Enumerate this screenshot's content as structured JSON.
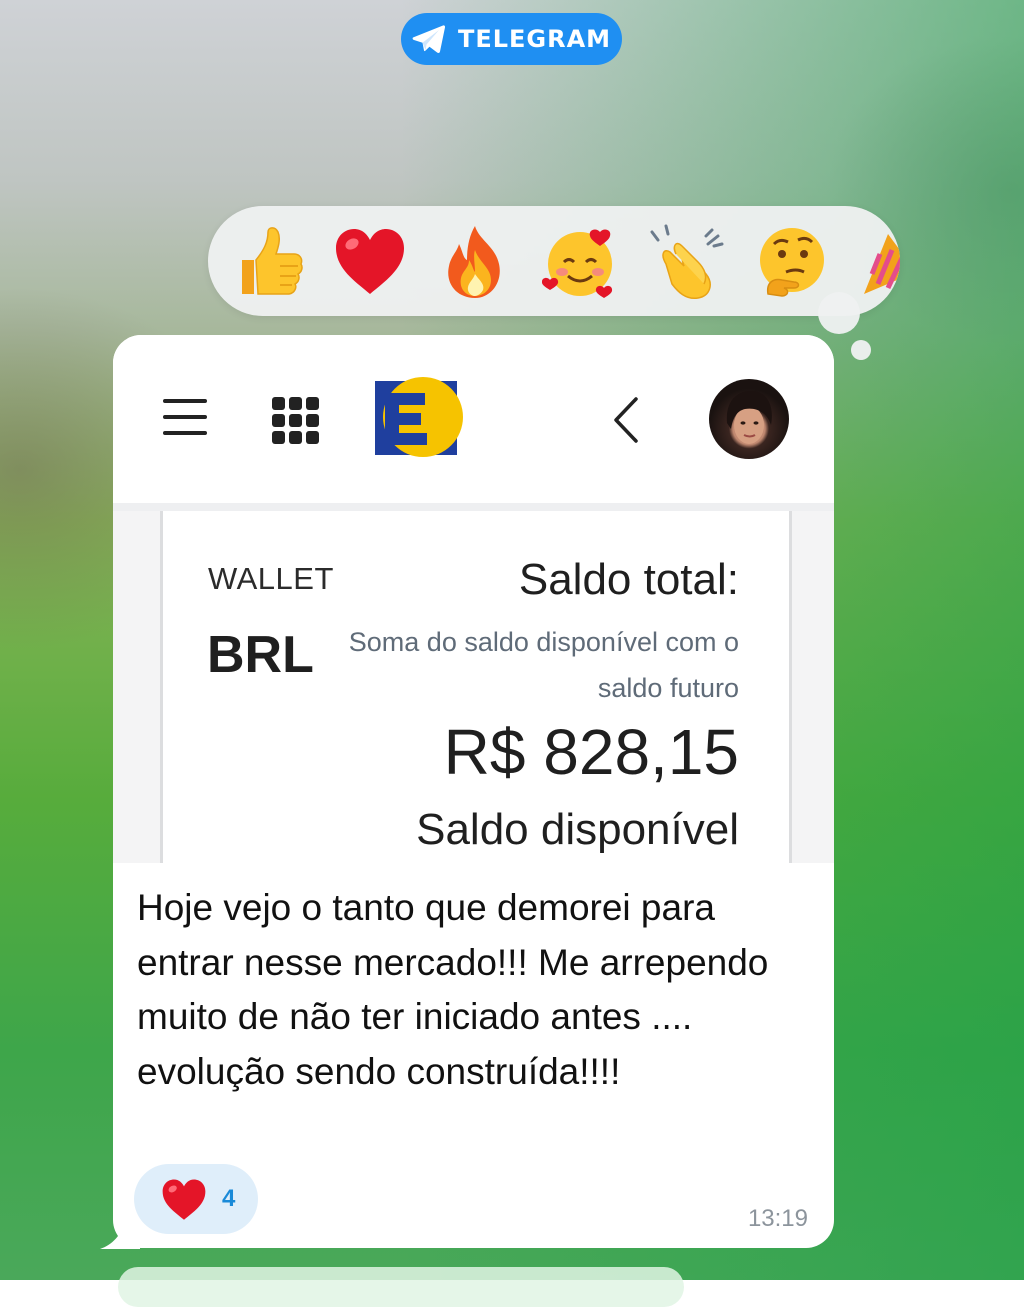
{
  "top_badge": {
    "label": "TELEGRAM",
    "icon": "telegram-plane-icon",
    "color": "#1f8ff2"
  },
  "reactions_bar": {
    "emojis": [
      "thumbs-up",
      "red-heart",
      "fire",
      "smiling-face-with-hearts",
      "clapping-hands",
      "thinking-face",
      "party-popper"
    ]
  },
  "screenshot": {
    "header": {
      "menu_icon": "hamburger-icon",
      "apps_icon": "grid-icon",
      "logo": "e-logo",
      "back_icon": "chevron-left-icon",
      "avatar": "user-avatar"
    },
    "wallet": {
      "label": "WALLET",
      "currency": "BRL",
      "saldo_total_label": "Saldo total:",
      "saldo_total_desc": "Soma do saldo disponível com o saldo futuro",
      "amount": "R$ 828,15",
      "saldo_disponivel_label": "Saldo disponível"
    }
  },
  "message": {
    "text": "Hoje vejo o tanto que demorei para entrar nesse mercado!!! Me arrependo muito de não ter iniciado antes .... evolução sendo construída!!!!",
    "reaction": {
      "emoji": "red-heart",
      "count": "4"
    },
    "time": "13:19"
  },
  "colors": {
    "accent": "#1f8ff2",
    "logo_blue": "#1f3f9e",
    "logo_yellow": "#f6c300",
    "reaction_count": "#1a8ad8"
  }
}
